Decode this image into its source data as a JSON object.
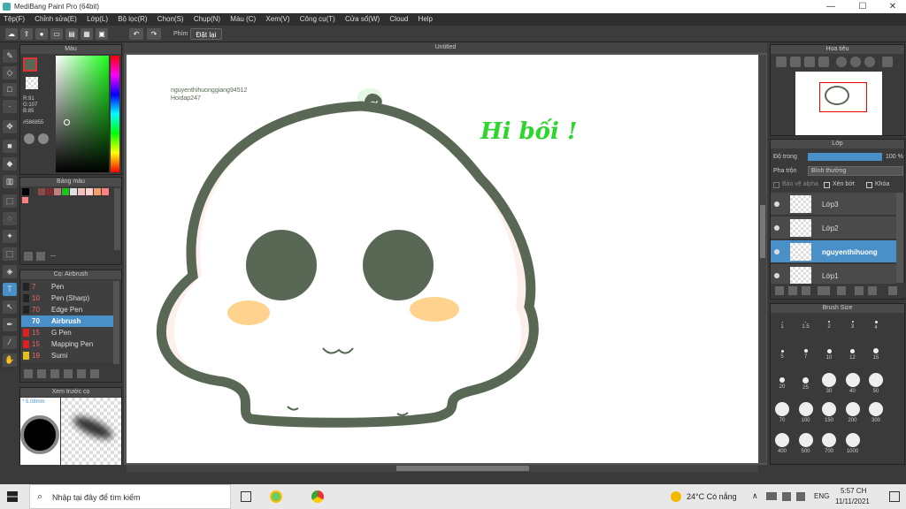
{
  "window": {
    "title": "MediBang Paint Pro (64bit)",
    "minimize": "—",
    "maximize": "☐",
    "close": "✕"
  },
  "menu": [
    "Tệp(F)",
    "Chỉnh sửa(E)",
    "Lớp(L)",
    "Bộ lọc(R)",
    "Chọn(S)",
    "Chụp(N)",
    "Màu (C)",
    "Xem(V)",
    "Công cụ(T)",
    "Cửa sổ(W)",
    "Cloud",
    "Help"
  ],
  "toolbar": {
    "shortcut_label": "Phím",
    "reset_label": "Đặt lại"
  },
  "color_panel": {
    "title": "Màu",
    "r": "R:91",
    "g": "G:107",
    "b": "B:85",
    "hex": "#586855",
    "primary": "#586855"
  },
  "palette_panel": {
    "title": "Bảng màu",
    "swatches": [
      "#000000",
      "#3a3a3a",
      "#8b4a4a",
      "#7a3030",
      "#c08080",
      "#20c020",
      "#e0e0e0",
      "#f0c0c0",
      "#ffd0d0",
      "#f0a070",
      "#ff8080"
    ],
    "footer": "---"
  },
  "brush_panel": {
    "title": "Cọ: Airbrush",
    "items": [
      {
        "size": "7",
        "name": "Pen",
        "color": "#222222"
      },
      {
        "size": "10",
        "name": "Pen (Sharp)",
        "color": "#222222"
      },
      {
        "size": "70",
        "name": "Edge Pen",
        "color": "#222222"
      },
      {
        "size": "70",
        "name": "Airbrush",
        "color": "#4a90c8"
      },
      {
        "size": "15",
        "name": "G Pen",
        "color": "#e02020"
      },
      {
        "size": "15",
        "name": "Mapping Pen",
        "color": "#e02020"
      },
      {
        "size": "19",
        "name": "Sumi",
        "color": "#e0c020"
      }
    ]
  },
  "preview_panel": {
    "title": "Xem trước cọ",
    "size": "* 5.08mm"
  },
  "canvas": {
    "tab": "Untitled",
    "watermark1": "nguyenthihuonggiang94512",
    "watermark2": "Hoidap247",
    "greeting": "Hi bối !"
  },
  "navigator": {
    "title": "Hoa tiêu"
  },
  "layer_panel": {
    "title": "Lớp",
    "opacity_label": "Độ trong",
    "opacity_value": "100 %",
    "blend_label": "Pha trộn",
    "blend_value": "Bình thường",
    "protect_alpha": "Bảo vệ alpha",
    "clipping": "Xén bớt",
    "lock": "Khóa",
    "layers": [
      {
        "name": "Lớp3",
        "selected": false
      },
      {
        "name": "Lớp2",
        "selected": false
      },
      {
        "name": "nguyenthihuong",
        "selected": true
      },
      {
        "name": "Lớp1",
        "selected": false
      }
    ]
  },
  "brush_size_panel": {
    "title": "Brush Size",
    "sizes": [
      "1",
      "1.5",
      "2",
      "3",
      "4",
      "5",
      "7",
      "10",
      "12",
      "15",
      "20",
      "25",
      "30",
      "40",
      "50",
      "70",
      "100",
      "150",
      "200",
      "300",
      "400",
      "500",
      "700",
      "1000"
    ]
  },
  "taskbar": {
    "search": "Nhập tại đây để tìm kiếm",
    "weather": "24°C Có nắng",
    "lang": "ENG",
    "time": "5:57 CH",
    "date": "11/11/2021"
  }
}
